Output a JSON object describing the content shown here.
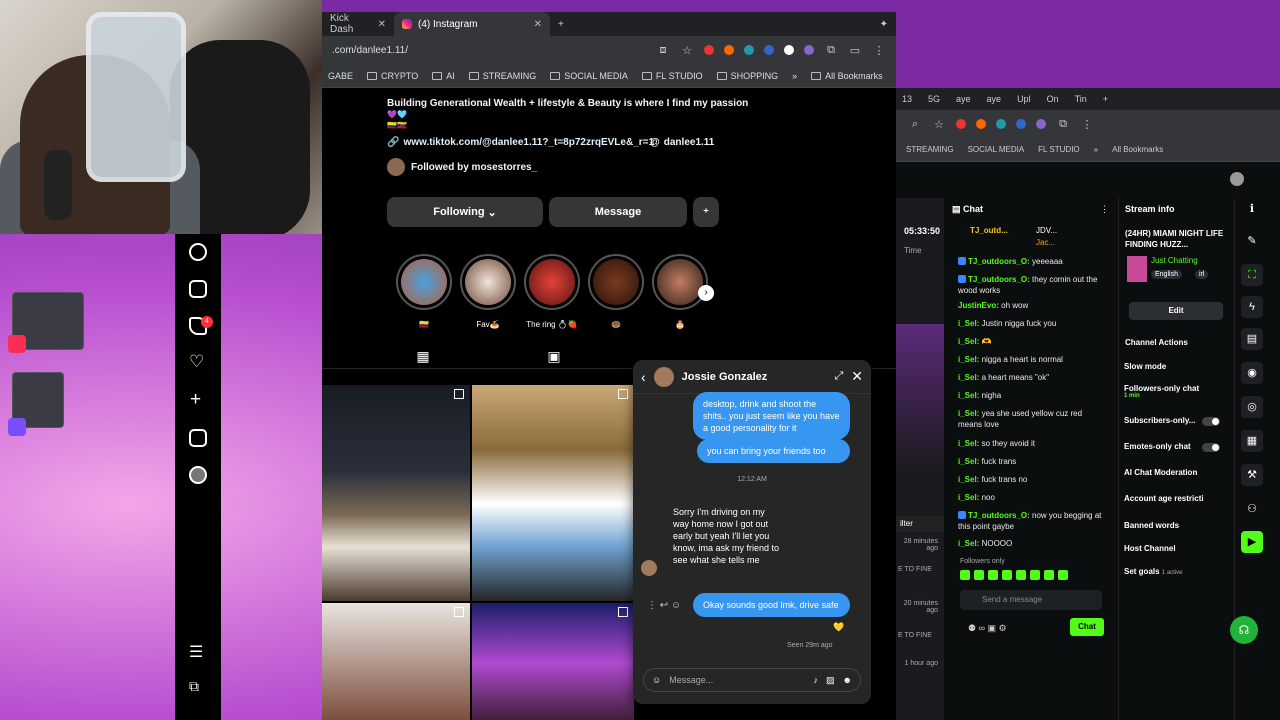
{
  "left_tabs": [
    {
      "label": "Kick Dash"
    },
    {
      "label": "(4) Instagram"
    }
  ],
  "left_url": ".com/danlee1.11/",
  "bookmarks": [
    "GABE",
    "CRYPTO",
    "AI",
    "STREAMING",
    "SOCIAL MEDIA",
    "FL STUDIO",
    "SHOPPING",
    "All Bookmarks"
  ],
  "profile": {
    "bio": "Building Generational Wealth + lifestyle & Beauty is where I find my passion",
    "bio_emoji": "💜🩵",
    "bio_flag": "🇨🇴🇻🇪",
    "link": "www.tiktok.com/@danlee1.11?_t=8p72zrqEVLe&_r=1",
    "threads": "danlee1.11",
    "followed_by": "Followed by mosestorres_",
    "following_label": "Following",
    "message_label": "Message",
    "highlights": [
      "🇨🇴",
      "Fav🍝",
      "The ring 💍🍓",
      "🍩",
      "🎂"
    ]
  },
  "dm": {
    "name": "Jossie Gonzalez",
    "messages": [
      {
        "from": "me",
        "text": "desktop, drink and shoot the shits.. you just seem like you have a good personality for it"
      },
      {
        "from": "me",
        "text": "you can bring your friends too"
      },
      {
        "from": "time",
        "text": "12:12 AM"
      },
      {
        "from": "them",
        "text": "Sorry I'm driving on my way home now I got out early but yeah I'll let you know,  ima ask my friend to see what she tells me"
      },
      {
        "from": "me",
        "text": "Okay sounds good lmk, drive safe"
      }
    ],
    "seen": "Seen 29m ago",
    "placeholder": "Message...",
    "heart": "💛"
  },
  "right_tabs": [
    "13",
    "5G",
    "aye",
    "aye",
    "Upl",
    "On",
    "Tin"
  ],
  "right_bookmarks": [
    "STREAMING",
    "SOCIAL MEDIA",
    "FL STUDIO",
    "All Bookmarks"
  ],
  "kick": {
    "chat_title": "Chat",
    "stream_info_title": "Stream info",
    "timer": "05:33:50",
    "timer_label": "Time",
    "leaders": [
      {
        "name": "TJ_outd...",
        "n": "5"
      },
      {
        "name": "JDV...",
        "n": "5"
      },
      {
        "name": "Jac...",
        "n": "5"
      }
    ],
    "chat": [
      {
        "user": "TJ_outdoors_O:",
        "msg": "yeeeaaa"
      },
      {
        "user": "TJ_outdoors_O:",
        "msg": "they comin out the wood works"
      },
      {
        "user": "JustinEvo:",
        "msg": "oh wow"
      },
      {
        "user": "i_Sel:",
        "msg": "Justin nigga fuck you"
      },
      {
        "user": "i_Sel:",
        "msg": "🫶"
      },
      {
        "user": "i_Sel:",
        "msg": "nigga a heart is normal"
      },
      {
        "user": "i_Sel:",
        "msg": "a heart means \"ok\""
      },
      {
        "user": "i_Sel:",
        "msg": "nigha"
      },
      {
        "user": "i_Sel:",
        "msg": "yea she used yellow cuz red means love"
      },
      {
        "user": "i_Sel:",
        "msg": "so they avoid it"
      },
      {
        "user": "i_Sel:",
        "msg": "fuck trans"
      },
      {
        "user": "i_Sel:",
        "msg": "fuck trans no"
      },
      {
        "user": "i_Sel:",
        "msg": "noo"
      },
      {
        "user": "TJ_outdoors_O:",
        "msg": "now you begging at this point gaybe"
      },
      {
        "user": "i_Sel:",
        "msg": "NOOOO"
      }
    ],
    "followers_only": "Followers only",
    "send_placeholder": "Send a message",
    "chat_button": "Chat",
    "stream_title": "(24HR) MIAMI NIGHT LIFE FINDING HUZZ...",
    "category": "Just Chatting",
    "tags": [
      "English",
      "irl"
    ],
    "edit_label": "Edit",
    "channel_actions": "Channel Actions",
    "actions": [
      {
        "label": "Slow mode",
        "sub": ""
      },
      {
        "label": "Followers-only chat",
        "sub": "1 min"
      },
      {
        "label": "Subscribers-only...",
        "sub": ""
      },
      {
        "label": "Emotes-only chat",
        "sub": ""
      },
      {
        "label": "AI Chat Moderation",
        "sub": ""
      },
      {
        "label": "Account age restricti",
        "sub": ""
      },
      {
        "label": "Banned words",
        "sub": ""
      },
      {
        "label": "Host Channel",
        "sub": ""
      },
      {
        "label": "Set goals",
        "sub": "1 active"
      }
    ],
    "filter_label": "ilter",
    "side_times": [
      "28 minutes ago",
      "20 minutes ago",
      "1 hour ago"
    ],
    "side_tag": "E TO FINE"
  },
  "colors": {
    "kick_green": "#53fc18",
    "ig_blue": "#3797f0"
  }
}
